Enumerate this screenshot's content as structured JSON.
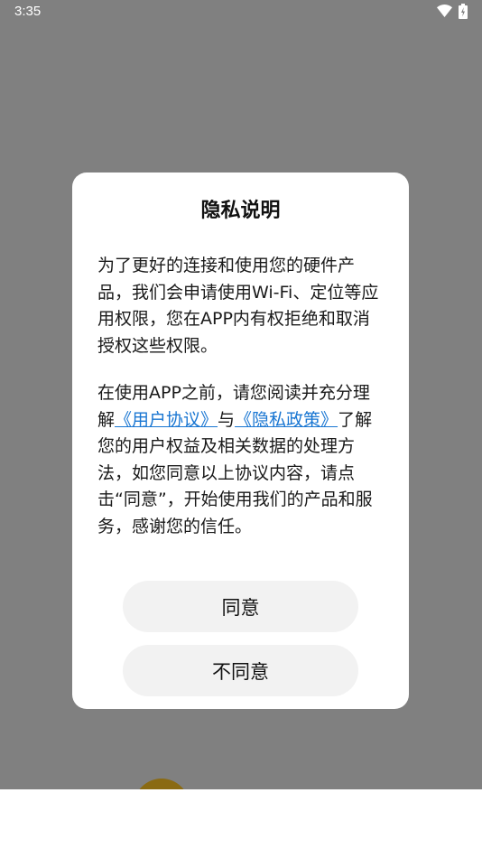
{
  "status_bar": {
    "time": "3:35",
    "icons": [
      "wifi-icon",
      "battery-icon"
    ]
  },
  "dialog": {
    "title": "隐私说明",
    "paragraph1": "为了更好的连接和使用您的硬件产品，我们会申请使用Wi-Fi、定位等应用权限，您在APP内有权拒绝和取消授权这些权限。",
    "paragraph2_prefix": "在使用APP之前，请您阅读并充分理解",
    "user_agreement_link": "《用户协议》",
    "paragraph2_joiner": "与",
    "privacy_policy_link": "《隐私政策》",
    "paragraph2_suffix": "了解您的用户权益及相关数据的处理方法，如您同意以上协议内容，请点击“同意”，开始使用我们的产品和服务，感谢您的信任。",
    "agree_label": "同意",
    "disagree_label": "不同意"
  },
  "colors": {
    "overlay": "#808080",
    "link": "#1976d2",
    "button_bg": "#f2f2f2",
    "dialog_bg": "#ffffff"
  }
}
